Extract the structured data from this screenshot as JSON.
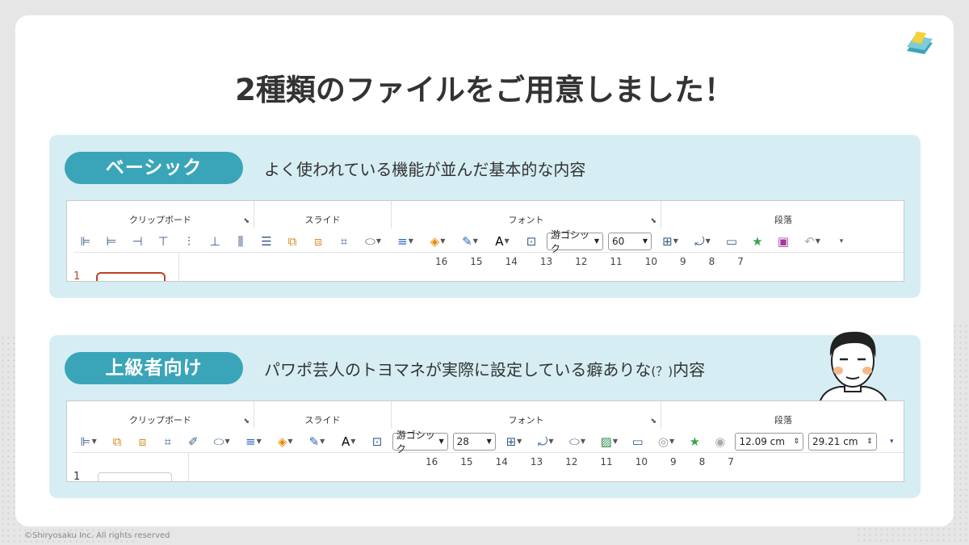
{
  "title": "2種類のファイルをご用意しました！",
  "colors": {
    "accent": "#3aa5b8",
    "panel": "#d6eef3",
    "text": "#333333"
  },
  "basic": {
    "badge": "ベーシック",
    "description": "よく使われている機能が並んだ基本的な内容",
    "ribbon_groups": [
      "クリップボード",
      "スライド",
      "フォント",
      "段落"
    ],
    "font_name": "游ゴシック",
    "font_size": "60",
    "ruler": [
      "16",
      "15",
      "14",
      "13",
      "12",
      "11",
      "10",
      "9",
      "8",
      "7"
    ],
    "slide_number": "1"
  },
  "advanced": {
    "badge": "上級者向け",
    "description_main": "パワポ芸人のトヨマネが実際に設定している癖ありな",
    "description_q": "(？)",
    "description_end": "内容",
    "ribbon_groups": [
      "クリップボード",
      "スライド",
      "フォント",
      "段落"
    ],
    "font_name": "游ゴシック",
    "font_size": "28",
    "width_value": "12.09 cm",
    "height_value": "29.21 cm",
    "ruler": [
      "16",
      "15",
      "14",
      "13",
      "12",
      "11",
      "10",
      "9",
      "8",
      "7"
    ],
    "slide_number": "1"
  },
  "copyright": "©Shiryosaku Inc. All rights reserved"
}
